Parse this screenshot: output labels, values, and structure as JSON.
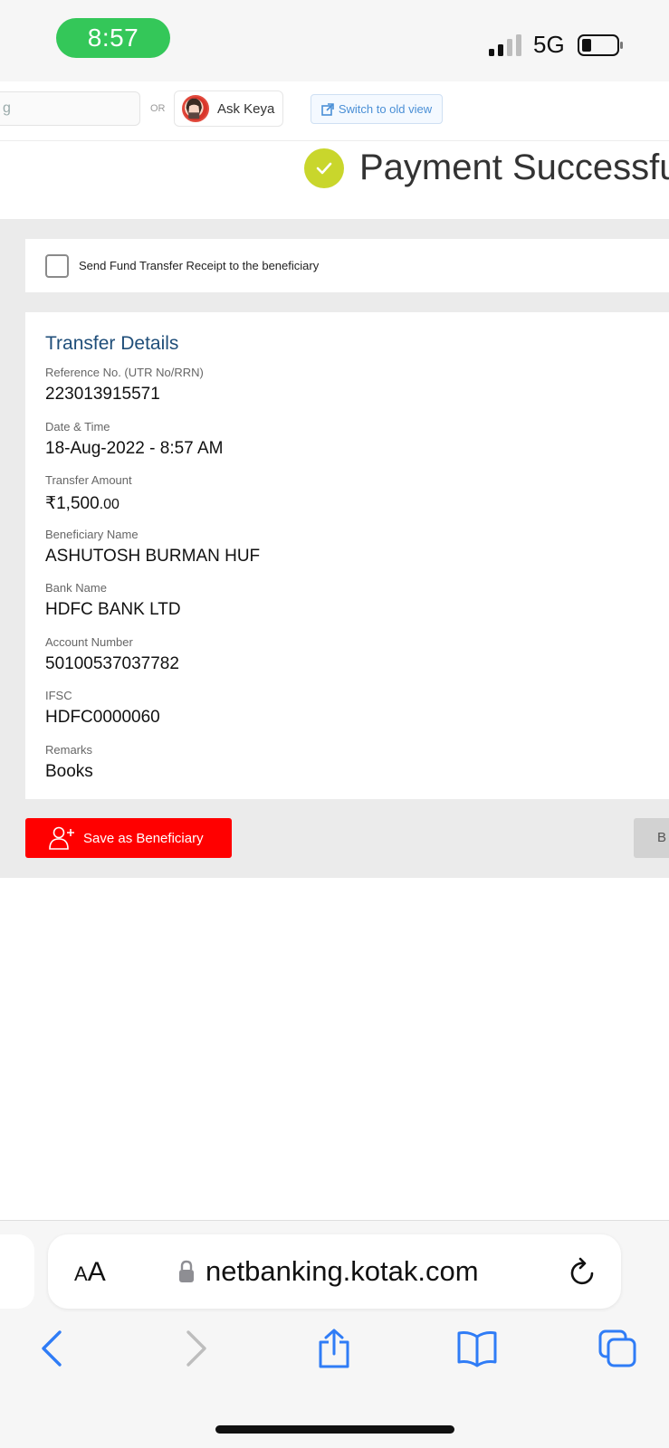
{
  "status_bar": {
    "time": "8:57",
    "network": "5G"
  },
  "toolbar": {
    "search_partial": "g",
    "or_text": "OR",
    "ask_keya_label": "Ask Keya",
    "switch_view_label": "Switch to old view"
  },
  "header": {
    "title": "Payment Successfu"
  },
  "receipt": {
    "label": "Send Fund Transfer Receipt to the beneficiary",
    "checked": false
  },
  "transfer_details": {
    "title": "Transfer Details",
    "reference_label": "Reference No. (UTR No/RRN)",
    "reference_value": "223013915571",
    "datetime_label": "Date & Time",
    "datetime_value": "18-Aug-2022 - 8:57 AM",
    "amount_label": "Transfer Amount",
    "amount_currency": "₹",
    "amount_main": "1,500",
    "amount_cents": ".00",
    "beneficiary_label": "Beneficiary Name",
    "beneficiary_value": "ASHUTOSH BURMAN HUF",
    "bank_label": "Bank Name",
    "bank_value": "HDFC BANK LTD",
    "account_label": "Account Number",
    "account_value": "50100537037782",
    "ifsc_label": "IFSC",
    "ifsc_value": "HDFC0000060",
    "remarks_label": "Remarks",
    "remarks_value": "Books"
  },
  "actions": {
    "save_beneficiary_label": "Save as Beneficiary",
    "back_partial": "B"
  },
  "browser": {
    "aa_big": "A",
    "aa_small": "A",
    "url": "netbanking.kotak.com"
  },
  "colors": {
    "accent_red": "#ff0000",
    "success_green": "#c9d62c",
    "title_blue": "#1f4e79",
    "pill_green": "#34c759"
  },
  "icons": {
    "check": "check-icon",
    "lock": "lock-icon",
    "reload": "reload-icon",
    "back": "chevron-left-icon",
    "forward": "chevron-right-icon",
    "share": "share-icon",
    "bookmarks": "book-icon",
    "tabs": "tabs-icon",
    "add_user": "add-user-icon",
    "external_link": "external-link-icon"
  }
}
